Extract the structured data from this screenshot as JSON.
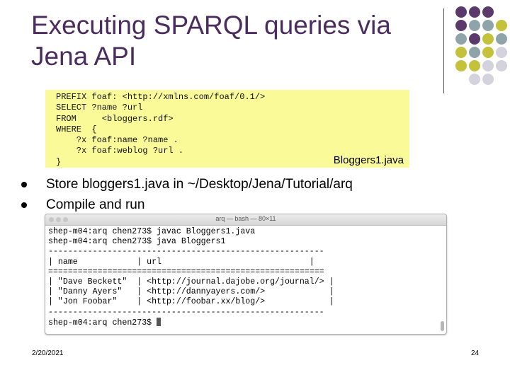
{
  "slide": {
    "title_line1": "Executing SPARQL queries via",
    "title_line2": "Jena API",
    "query_code": "PREFIX foaf: <http://xmlns.com/foaf/0.1/>\nSELECT ?name ?url\nFROM     <bloggers.rdf>\nWHERE  {\n    ?x foaf:name ?name .\n    ?x foaf:weblog ?url .\n}",
    "code_caption": "Bloggers1.java",
    "bullets": [
      "Store bloggers1.java in ~/Desktop/Jena/Tutorial/arq",
      "Compile and run"
    ],
    "date": "2/20/2021",
    "page_number": "24"
  },
  "terminal": {
    "title": "arq — bash — 80×11",
    "lines": [
      "shep-m04:arq chen273$ javac Bloggers1.java",
      "shep-m04:arq chen273$ java Bloggers1",
      "--------------------------------------------------------",
      "| name            | url                              |",
      "========================================================",
      "| \"Dave Beckett\"  | <http://journal.dajobe.org/journal/> |",
      "| \"Danny Ayers\"   | <http://dannyayers.com/>             |",
      "| \"Jon Foobar\"    | <http://foobar.xx/blog/>             |",
      "--------------------------------------------------------",
      "shep-m04:arq chen273$ "
    ]
  },
  "colors": {
    "title": "#4b2c5e",
    "code_background": "#fafa99",
    "dot_purple": "#5b3a6b",
    "dot_teal": "#8fa4a8",
    "dot_olive": "#c4c23a",
    "dot_light": "#d4d2dc"
  }
}
